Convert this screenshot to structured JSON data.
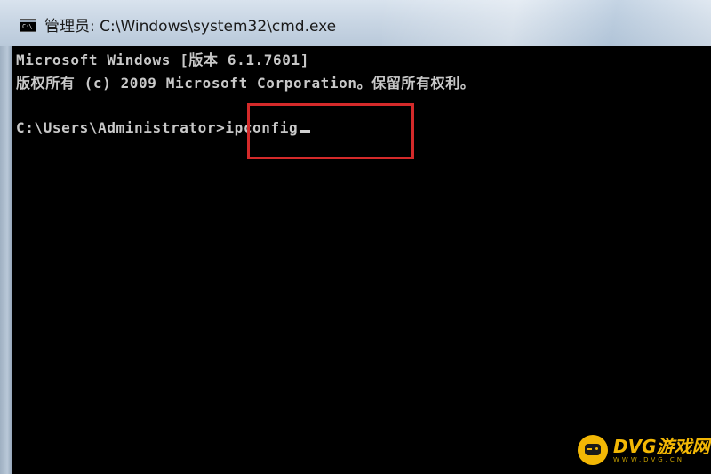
{
  "window": {
    "title": "管理员: C:\\Windows\\system32\\cmd.exe",
    "icon": "cmd-console-icon"
  },
  "console": {
    "lines": [
      "Microsoft Windows [版本 6.1.7601]",
      "版权所有 (c) 2009 Microsoft Corporation。保留所有权利。"
    ],
    "prompt": "C:\\Users\\Administrator>",
    "command": "ipconfig"
  },
  "annotation": {
    "highlight_color": "#d42a2a"
  },
  "watermark": {
    "name": "DVG游戏网",
    "url": "WWW.DVG.CN",
    "color": "#f2b705"
  }
}
